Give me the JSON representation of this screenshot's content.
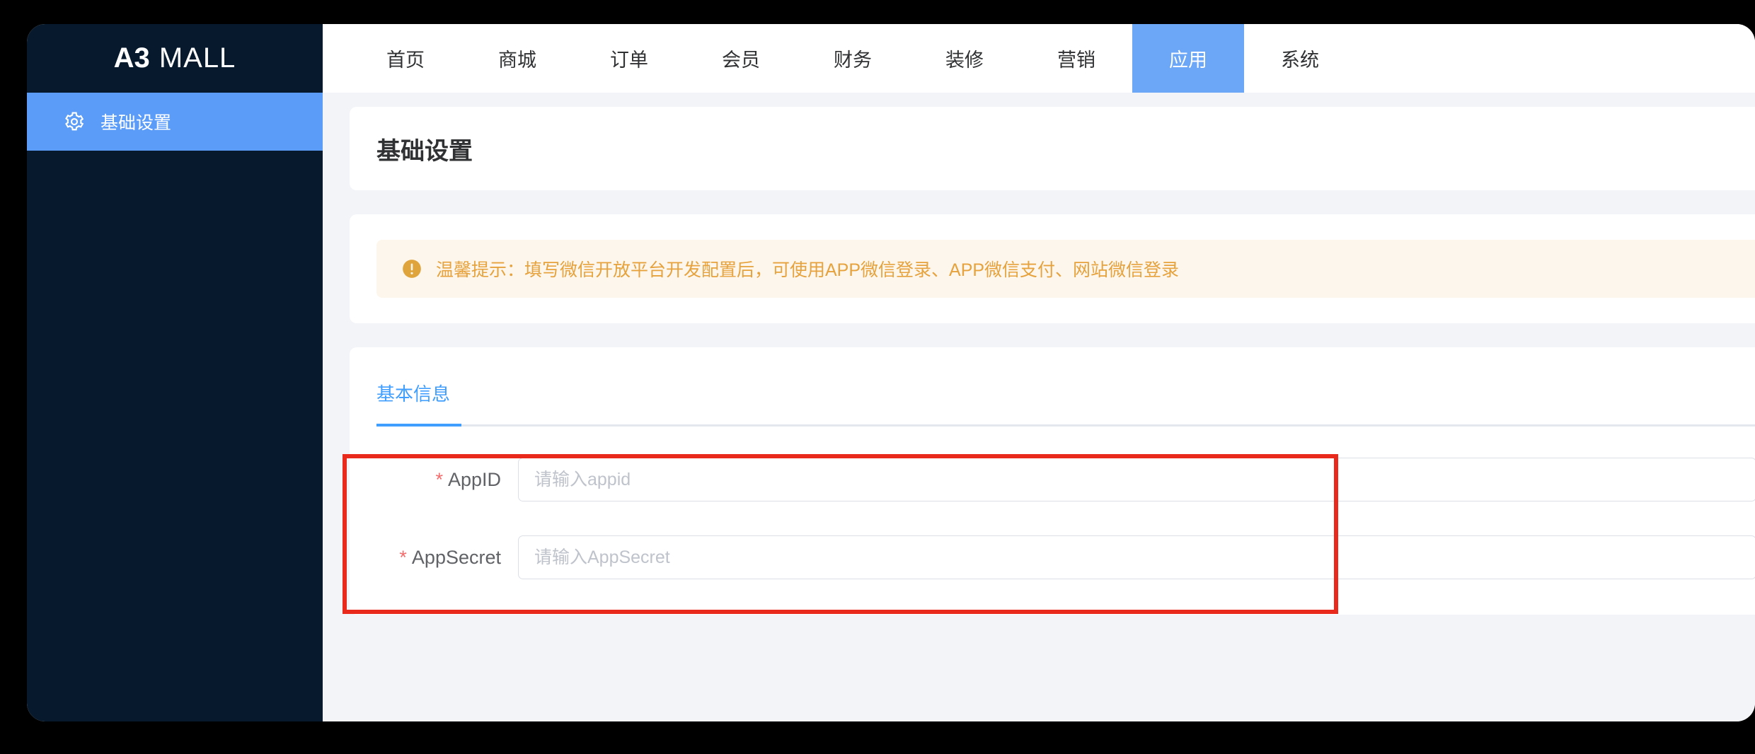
{
  "brand": {
    "strong": "A3",
    "light": "MALL"
  },
  "sidebar": {
    "items": [
      {
        "label": "基础设置",
        "icon": "gear-icon",
        "active": true
      }
    ]
  },
  "topnav": {
    "tabs": [
      {
        "label": "首页",
        "active": false
      },
      {
        "label": "商城",
        "active": false
      },
      {
        "label": "订单",
        "active": false
      },
      {
        "label": "会员",
        "active": false
      },
      {
        "label": "财务",
        "active": false
      },
      {
        "label": "装修",
        "active": false
      },
      {
        "label": "营销",
        "active": false
      },
      {
        "label": "应用",
        "active": true
      },
      {
        "label": "系统",
        "active": false
      }
    ]
  },
  "page": {
    "title": "基础设置"
  },
  "alert": {
    "icon": "warning-circle-icon",
    "text": "温馨提示：填写微信开放平台开发配置后，可使用APP微信登录、APP微信支付、网站微信登录"
  },
  "form": {
    "tabs": [
      {
        "label": "基本信息",
        "active": true
      }
    ],
    "fields": [
      {
        "label": "AppID",
        "required": "*",
        "placeholder": "请输入appid",
        "value": ""
      },
      {
        "label": "AppSecret",
        "required": "*",
        "placeholder": "请输入AppSecret",
        "value": ""
      }
    ]
  },
  "colors": {
    "sidebar_bg": "#07192C",
    "sidebar_active": "#5B9CF8",
    "nav_active": "#6CA6F6",
    "page_bg": "#F2F4F7",
    "accent_blue": "#409EFF",
    "warning": "#E6A23C",
    "warning_bg": "#FDF6EC",
    "required_red": "#F56C6C",
    "annotation_red": "#E8291C"
  }
}
